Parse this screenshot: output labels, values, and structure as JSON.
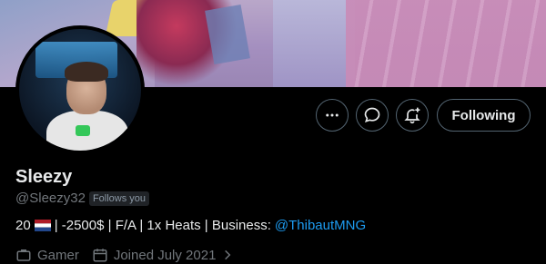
{
  "profile": {
    "display_name": "Sleezy",
    "handle": "@Sleezy32",
    "follows_you_badge": "Follows you",
    "bio": {
      "age": "20",
      "flag": "netherlands-flag",
      "text": "| -2500$ | F/A | 1x Heats | Business:",
      "mention": "@ThibautMNG"
    },
    "meta": {
      "category": "Gamer",
      "joined": "Joined July 2021"
    }
  },
  "actions": {
    "more_icon": "more-icon",
    "message_icon": "message-icon",
    "notifications_icon": "bell-plus-icon",
    "follow_label": "Following"
  },
  "colors": {
    "background": "#000000",
    "text": "#e7e9ea",
    "muted": "#71767b",
    "link": "#1d9bf0",
    "border": "#536471"
  }
}
